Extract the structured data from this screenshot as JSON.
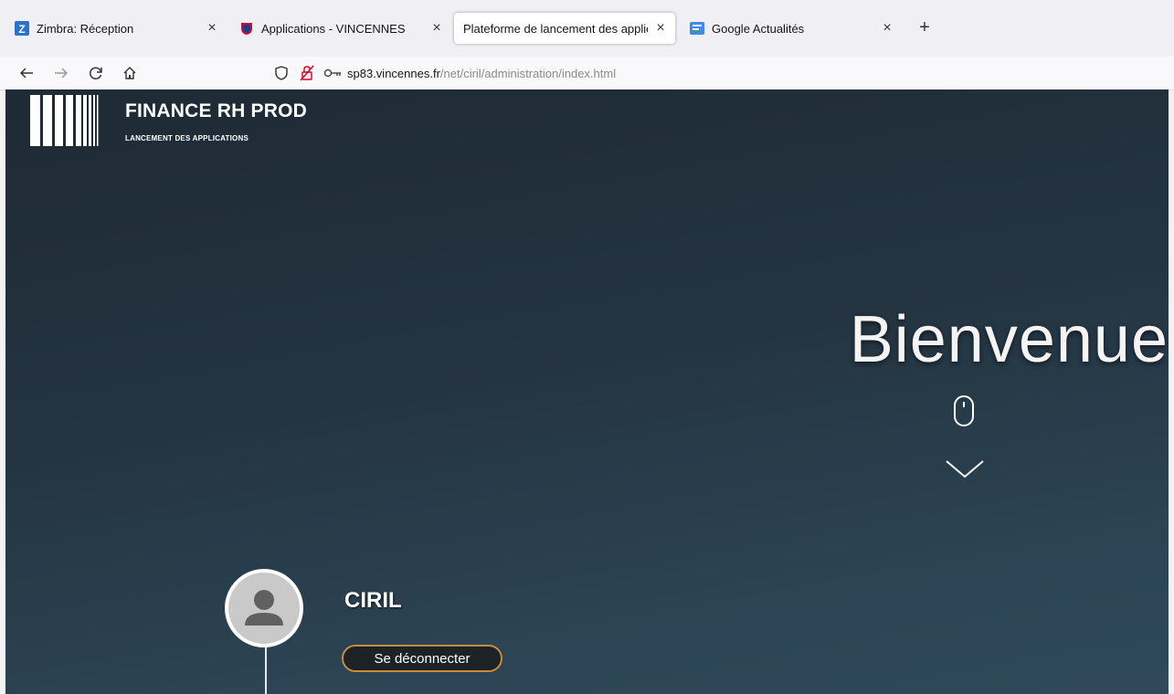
{
  "tabs": [
    {
      "title": "Zimbra: Réception",
      "close": "×",
      "favicon": "zimbra-icon"
    },
    {
      "title": "Applications - VINCENNES",
      "close": "×",
      "favicon": "vincennes-crest-icon"
    },
    {
      "title": "Plateforme de lancement des applic",
      "close": "×",
      "favicon": "none",
      "active": true
    },
    {
      "title": "Google Actualités",
      "close": "×",
      "favicon": "google-news-icon"
    }
  ],
  "new_tab": "+",
  "navbar": {
    "url_host": "sp83.vincennes.fr",
    "url_path": "/net/ciril/administration/index.html",
    "icons": [
      "back-arrow-icon",
      "forward-arrow-icon",
      "reload-icon",
      "home-icon",
      "shield-icon",
      "permissions-icon",
      "key-icon"
    ]
  },
  "page": {
    "brand_title": "FINANCE RH PROD",
    "brand_subtitle": "LANCEMENT DES APPLICATIONS",
    "welcome": "Bienvenue",
    "user_name": "CIRIL",
    "logout_label": "Se déconnecter"
  },
  "colors": {
    "page_bg_top": "#1e2a35",
    "page_bg_bottom": "#30495a",
    "logout_border": "#c98b3c",
    "text": "#ffffff"
  }
}
